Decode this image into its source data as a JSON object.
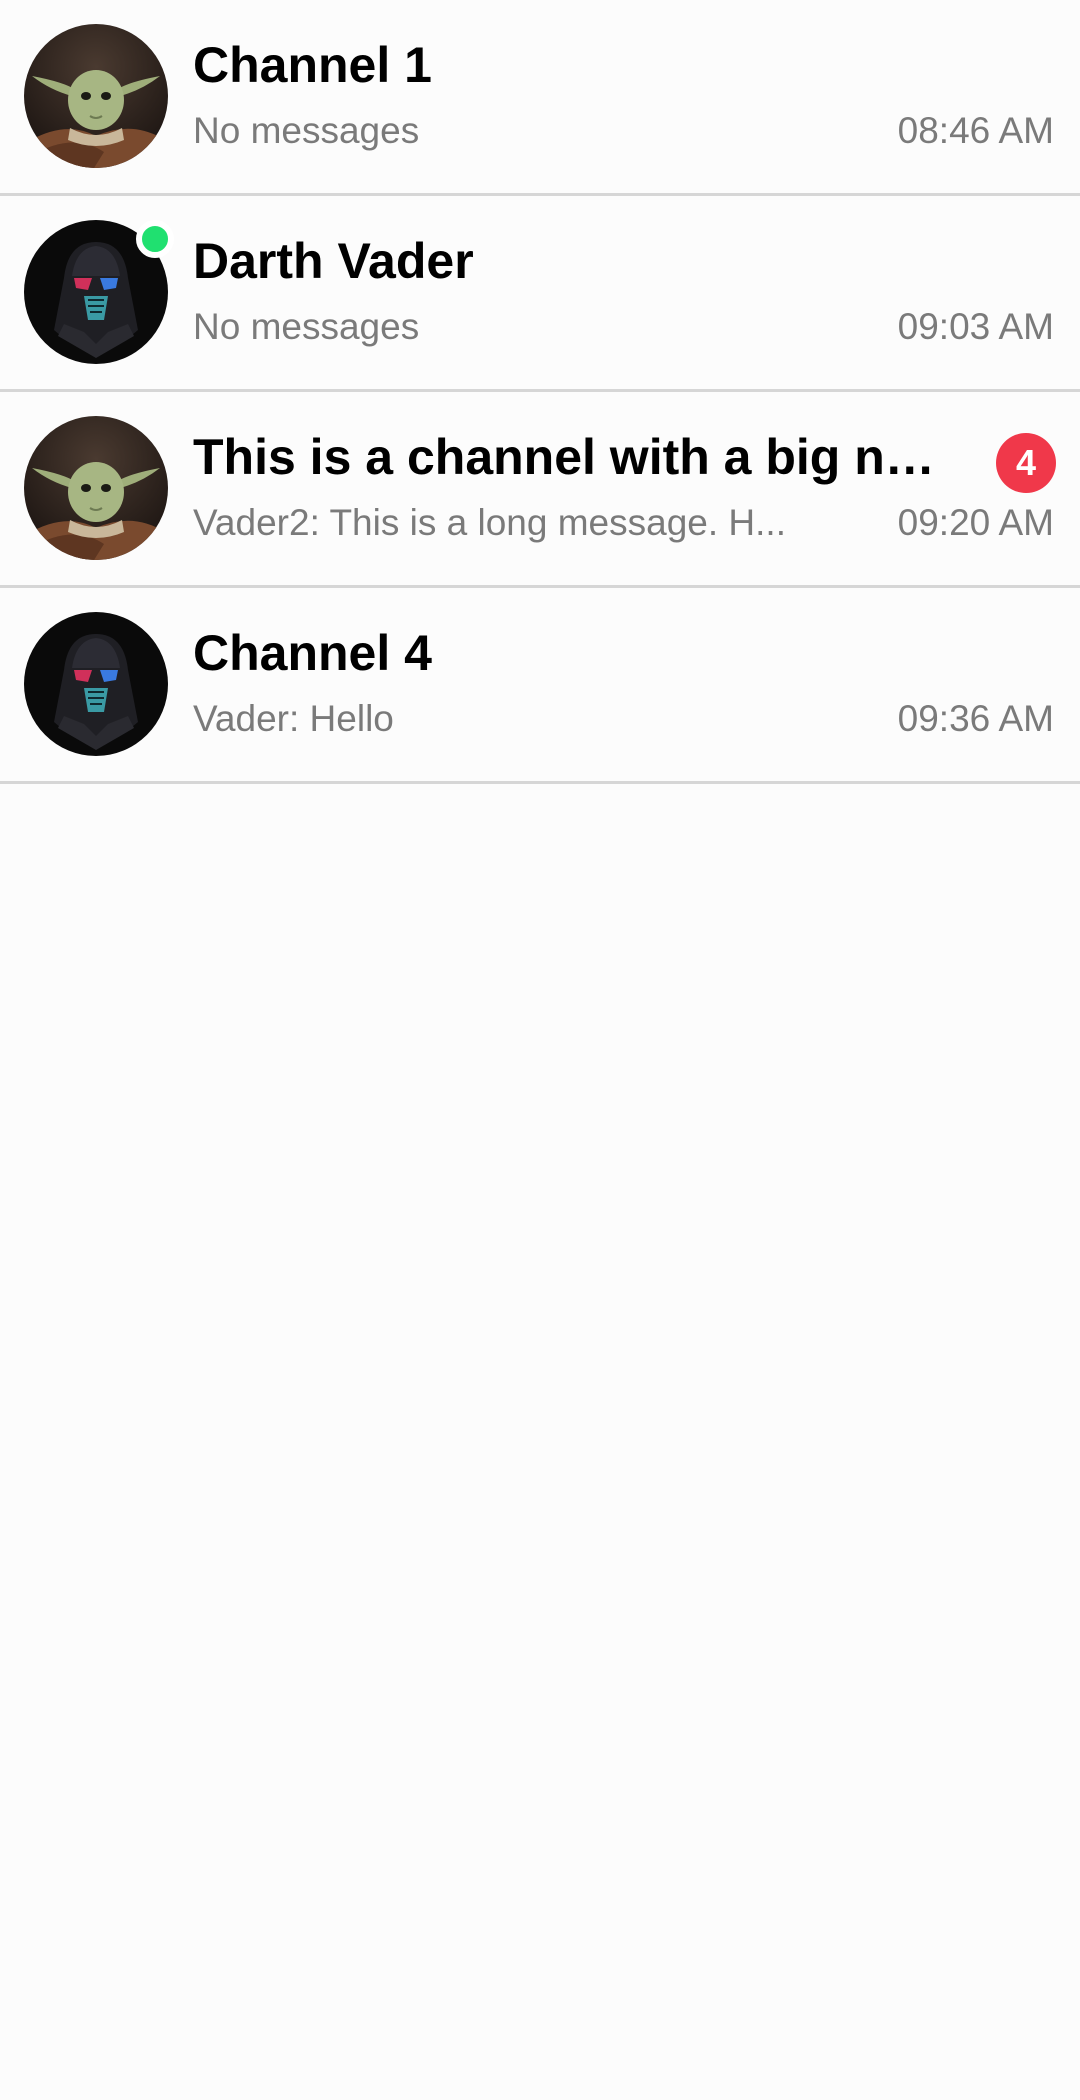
{
  "channels": [
    {
      "title": "Channel 1",
      "preview": "No messages",
      "time": "08:46 AM",
      "avatar": "yoda-avatar",
      "online": false,
      "unread": null
    },
    {
      "title": "Darth Vader",
      "preview": "No messages",
      "time": "09:03 AM",
      "avatar": "vader-avatar",
      "online": true,
      "unread": null
    },
    {
      "title": "This is a channel with a big na...",
      "preview": "Vader2: This is a long message. H...",
      "time": "09:20 AM",
      "avatar": "yoda-avatar",
      "online": false,
      "unread": "4"
    },
    {
      "title": "Channel 4",
      "preview": "Vader: Hello",
      "time": "09:36 AM",
      "avatar": "vader-avatar",
      "online": false,
      "unread": null
    }
  ],
  "colors": {
    "online": "#20e070",
    "badge": "#f0384a",
    "divider": "#d6d6d6",
    "secondary_text": "#7a7a7a"
  }
}
